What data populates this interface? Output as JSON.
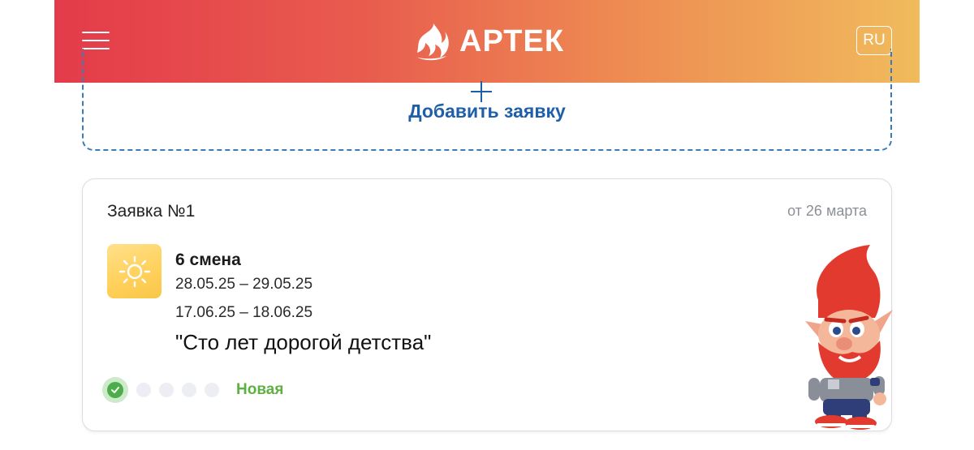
{
  "header": {
    "logo_text": "АРТЕК",
    "lang": "RU",
    "gradient": [
      "#e43b4a",
      "#f0bb5c"
    ]
  },
  "add_request": {
    "label": "Добавить заявку",
    "accent": "#1f5ea8"
  },
  "request": {
    "title": "Заявка №1",
    "date": "от 26 марта",
    "icon": "sun-icon",
    "shift_name": "6 смена",
    "dates": [
      "28.05.25 – 29.05.25",
      "17.06.25 – 18.06.25"
    ],
    "program": "\"Сто лет дорогой детства\"",
    "progress": {
      "completed_steps": 1,
      "total_steps": 5
    },
    "status": "Новая",
    "status_color": "#5fb043"
  }
}
